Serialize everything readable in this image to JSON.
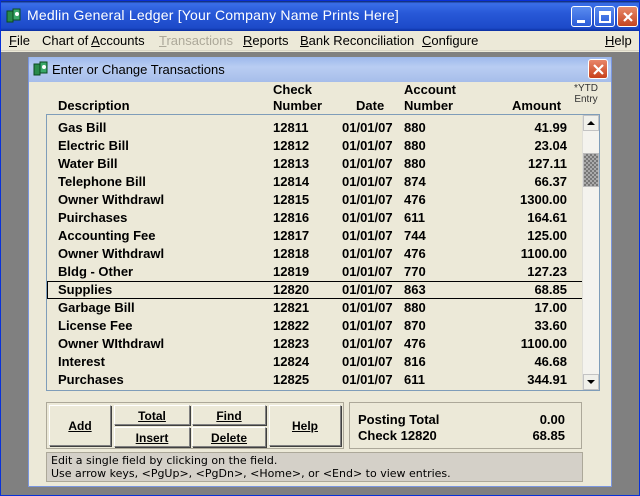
{
  "app": {
    "title": "Medlin General Ledger [Your Company Name Prints Here]"
  },
  "menu": {
    "items": [
      {
        "label": "File",
        "underline": "F",
        "enabled": true
      },
      {
        "label": "Chart of Accounts",
        "underline": "A",
        "enabled": true
      },
      {
        "label": "Transactions",
        "underline": "T",
        "enabled": false
      },
      {
        "label": "Reports",
        "underline": "R",
        "enabled": true
      },
      {
        "label": "Bank Reconciliation",
        "underline": "B",
        "enabled": true
      },
      {
        "label": "Configure",
        "underline": "C",
        "enabled": true
      },
      {
        "label": "Help",
        "underline": "H",
        "enabled": true
      }
    ]
  },
  "dialog": {
    "title": "Enter or Change Transactions"
  },
  "columns": {
    "description": "Description",
    "check_line1": "Check",
    "check_line2": "Number",
    "date": "Date",
    "account_line1": "Account",
    "account_line2": "Number",
    "amount": "Amount",
    "ytd_line1": "*YTD",
    "ytd_line2": "Entry"
  },
  "transactions": [
    {
      "description": "Gas Bill",
      "check": "12811",
      "date": "01/01/07",
      "account": "880",
      "amount": "41.99"
    },
    {
      "description": "Electric Bill",
      "check": "12812",
      "date": "01/01/07",
      "account": "880",
      "amount": "23.04"
    },
    {
      "description": "Water Bill",
      "check": "12813",
      "date": "01/01/07",
      "account": "880",
      "amount": "127.11"
    },
    {
      "description": "Telephone Bill",
      "check": "12814",
      "date": "01/01/07",
      "account": "874",
      "amount": "66.37"
    },
    {
      "description": "Owner Withdrawl",
      "check": "12815",
      "date": "01/01/07",
      "account": "476",
      "amount": "1300.00"
    },
    {
      "description": "Puirchases",
      "check": "12816",
      "date": "01/01/07",
      "account": "611",
      "amount": "164.61"
    },
    {
      "description": "Accounting Fee",
      "check": "12817",
      "date": "01/01/07",
      "account": "744",
      "amount": "125.00"
    },
    {
      "description": "Owner Withdrawl",
      "check": "12818",
      "date": "01/01/07",
      "account": "476",
      "amount": "1100.00"
    },
    {
      "description": "Bldg - Other",
      "check": "12819",
      "date": "01/01/07",
      "account": "770",
      "amount": "127.23"
    },
    {
      "description": "Supplies",
      "check": "12820",
      "date": "01/01/07",
      "account": "863",
      "amount": "68.85"
    },
    {
      "description": "Garbage Bill",
      "check": "12821",
      "date": "01/01/07",
      "account": "880",
      "amount": "17.00"
    },
    {
      "description": "License Fee",
      "check": "12822",
      "date": "01/01/07",
      "account": "870",
      "amount": "33.60"
    },
    {
      "description": "Owner WIthdrawl",
      "check": "12823",
      "date": "01/01/07",
      "account": "476",
      "amount": "1100.00"
    },
    {
      "description": "Interest",
      "check": "12824",
      "date": "01/01/07",
      "account": "816",
      "amount": "46.68"
    },
    {
      "description": "Purchases",
      "check": "12825",
      "date": "01/01/07",
      "account": "611",
      "amount": "344.91"
    }
  ],
  "selected_index": 9,
  "buttons": {
    "add": "Add",
    "total": "Total",
    "find": "Find",
    "help": "Help",
    "insert": "Insert",
    "delete": "Delete"
  },
  "posting": {
    "total_label": "Posting Total",
    "total_value": "0.00",
    "check_label": "Check 12820",
    "check_value": "68.85"
  },
  "status": {
    "line1": "Edit a single field by clicking on the field.",
    "line2": "Use arrow keys, <PgUp>, <PgDn>, <Home>, or <End> to view entries."
  },
  "colors": {
    "titlebar": "#2859d8",
    "dialog_titlebar": "#b9cdf2",
    "close_button": "#c8401c",
    "workspace": "#808080",
    "face": "#ece9d8"
  }
}
